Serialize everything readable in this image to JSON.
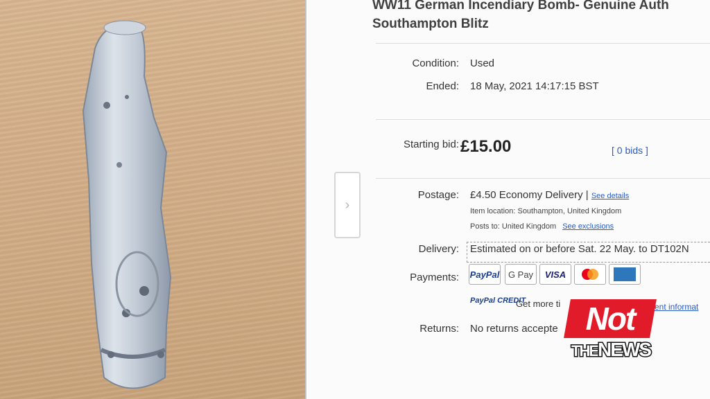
{
  "listing": {
    "title_line1": "WW11 German Incendiary Bomb- Genuine Auth",
    "title_line2": "Southampton Blitz"
  },
  "details": {
    "condition_label": "Condition:",
    "condition_value": "Used",
    "ended_label": "Ended:",
    "ended_value": "18 May, 2021  14:17:15 BST"
  },
  "bid": {
    "label": "Starting bid:",
    "price": "£15.00",
    "bids": "[ 0 bids ]"
  },
  "postage": {
    "label": "Postage:",
    "price": "£4.50",
    "method": "Economy Delivery |",
    "details_link": "See details",
    "location": "Item location:  Southampton, United Kingdom",
    "posts_to": "Posts to:  United Kingdom",
    "exclusions_link": "See exclusions"
  },
  "delivery": {
    "label": "Delivery:",
    "value": "Estimated on or before Sat. 22 May. to DT102N"
  },
  "payments": {
    "label": "Payments:",
    "methods": [
      "PayPal",
      "G Pay",
      "VISA",
      "Mastercard",
      "American Express"
    ],
    "credit_logo": "PayPal CREDIT",
    "credit_text": "Get more ti",
    "credit_link": "ent informat"
  },
  "returns": {
    "label": "Returns:",
    "value": "No returns accepte"
  },
  "watermark": {
    "line1": "Not",
    "line2_small": "THE",
    "line2": "NEWS"
  },
  "colors": {
    "link": "#2a5bc4",
    "logo_red": "#e21b2b",
    "table_surface": "#d2ad86"
  }
}
